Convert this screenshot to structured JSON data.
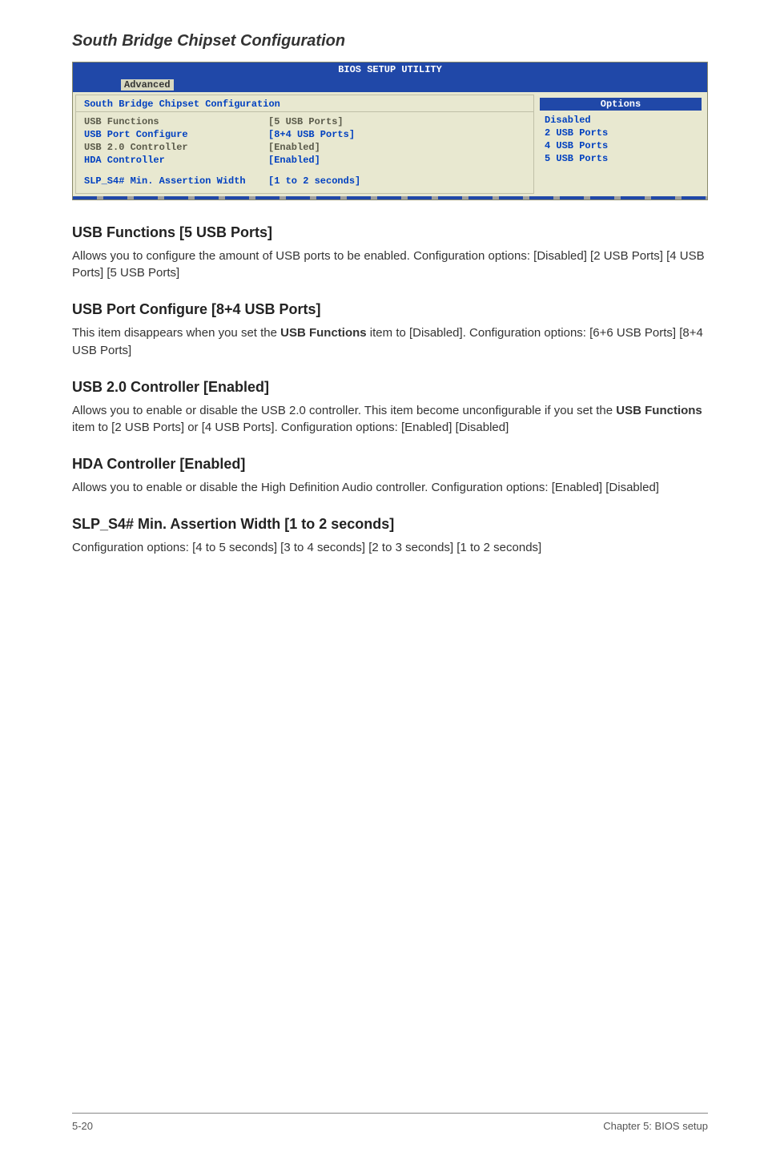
{
  "section_title": "South Bridge Chipset Configuration",
  "bios": {
    "title": "BIOS SETUP UTILITY",
    "tab": "Advanced",
    "subtitle": "South Bridge Chipset Configuration",
    "rows": [
      {
        "label": "USB Functions",
        "value": "[5 USB Ports]",
        "dim": true
      },
      {
        "label": "USB Port Configure",
        "value": "[8+4 USB Ports]",
        "dim": false
      },
      {
        "label": "USB 2.0 Controller",
        "value": "[Enabled]",
        "dim": true
      },
      {
        "label": "HDA Controller",
        "value": "[Enabled]",
        "dim": false
      }
    ],
    "extra_row": {
      "label": "SLP_S4# Min. Assertion Width",
      "value": "[1 to 2 seconds]"
    },
    "options_header": "Options",
    "options": [
      "Disabled",
      "2 USB Ports",
      "4 USB Ports",
      "5 USB Ports"
    ]
  },
  "settings": [
    {
      "title": "USB Functions [5 USB Ports]",
      "paras": [
        "Allows you to configure the amount of USB ports to be enabled. Configuration options: [Disabled] [2 USB Ports] [4 USB Ports] [5 USB Ports]"
      ]
    },
    {
      "title": "USB Port Configure [8+4 USB Ports]",
      "paras_html": [
        "This item disappears when you set the <b>USB Functions</b> item to [Disabled]. Configuration options: [6+6 USB Ports] [8+4 USB Ports]"
      ]
    },
    {
      "title": "USB 2.0 Controller [Enabled]",
      "paras_html": [
        "Allows you to enable or disable the USB 2.0 controller. This item become unconfigurable if you set the <b>USB Functions</b> item to [2 USB Ports] or [4 USB Ports]. Configuration options: [Enabled] [Disabled]"
      ]
    },
    {
      "title": "HDA Controller [Enabled]",
      "paras": [
        "Allows you to enable or disable the High Definition Audio controller. Configuration options: [Enabled] [Disabled]"
      ]
    },
    {
      "title": "SLP_S4# Min. Assertion Width [1 to 2 seconds]",
      "paras": [
        "Configuration options: [4 to 5 seconds] [3 to 4 seconds] [2 to 3 seconds] [1 to 2 seconds]"
      ]
    }
  ],
  "footer": {
    "left": "5-20",
    "right": "Chapter 5: BIOS setup"
  }
}
